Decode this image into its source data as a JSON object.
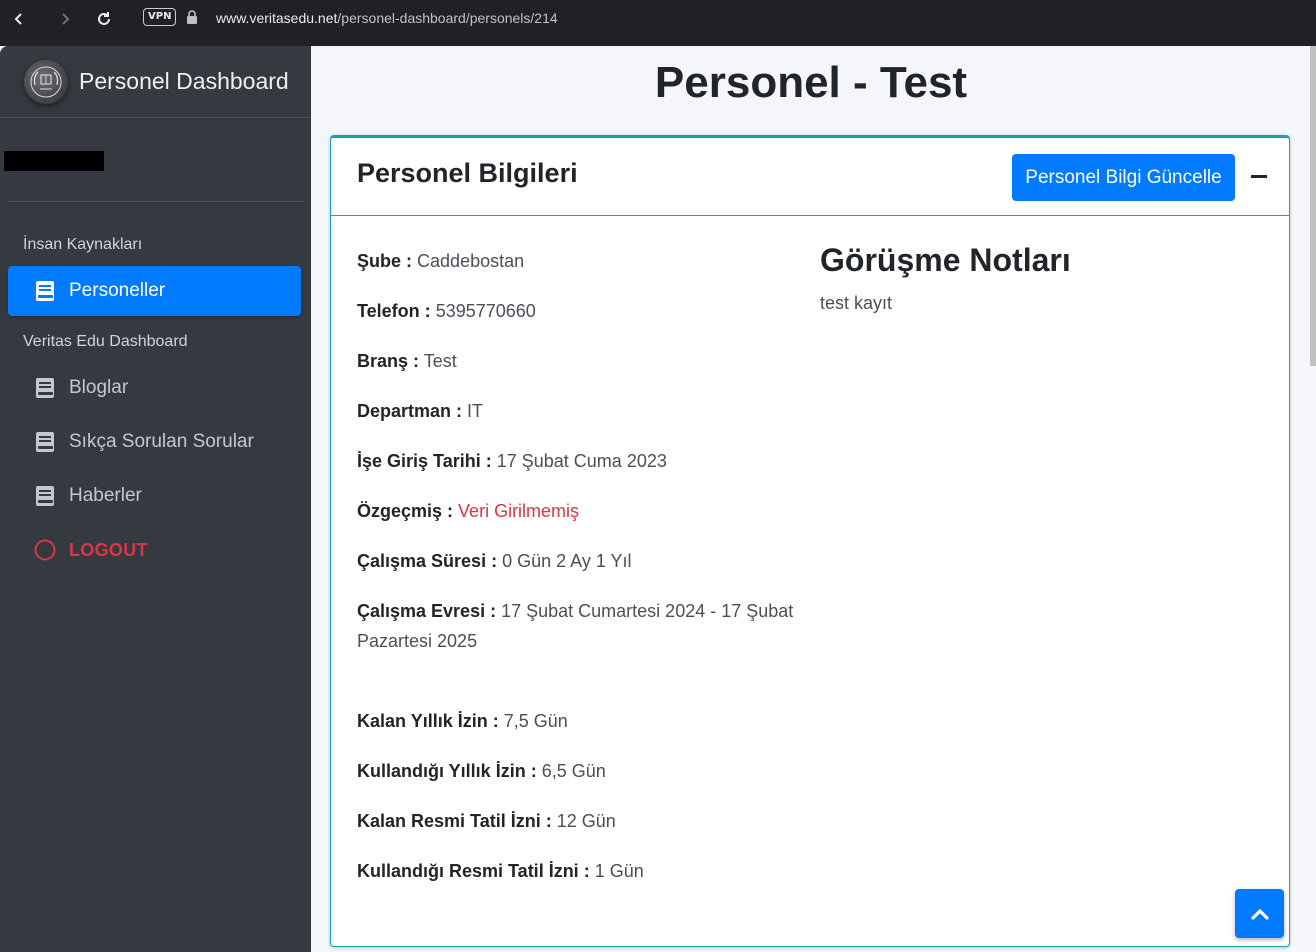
{
  "browser": {
    "vpn_label": "VPN",
    "url_host": "www.veritasedu.net",
    "url_path": "/personel-dashboard/personels/214"
  },
  "sidebar": {
    "brand_title": "Personel Dashboard",
    "sections": [
      {
        "header": "İnsan Kaynakları",
        "items": [
          {
            "label": "Personeller",
            "icon": "book-icon",
            "active": true
          }
        ]
      },
      {
        "header": "Veritas Edu Dashboard",
        "items": [
          {
            "label": "Bloglar",
            "icon": "book-icon"
          },
          {
            "label": "Sıkça Sorulan Sorular",
            "icon": "book-icon"
          },
          {
            "label": "Haberler",
            "icon": "book-icon"
          }
        ]
      }
    ],
    "logout_label": "LOGOUT"
  },
  "page": {
    "title": "Personel - Test"
  },
  "card": {
    "title": "Personel Bilgileri",
    "update_button": "Personel Bilgi Güncelle",
    "fields": [
      {
        "label": "Şube :",
        "value": "Caddebostan"
      },
      {
        "label": "Telefon :",
        "value": "5395770660"
      },
      {
        "label": "Branş :",
        "value": "Test"
      },
      {
        "label": "Departman :",
        "value": "IT"
      },
      {
        "label": "İşe Giriş Tarihi :",
        "value": "17 Şubat Cuma 2023"
      },
      {
        "label": "Özgeçmiş :",
        "value": "Veri Girilmemiş"
      },
      {
        "label": "Çalışma Süresi :",
        "value": "0 Gün 2 Ay 1 Yıl"
      },
      {
        "label": "Çalışma Evresi :",
        "value": "17 Şubat Cumartesi 2024 - 17 Şubat Pazartesi 2025"
      },
      {
        "label": "Kalan Yıllık İzin :",
        "value": "7,5 Gün"
      },
      {
        "label": "Kullandığı Yıllık İzin :",
        "value": "6,5 Gün"
      },
      {
        "label": "Kalan Resmi Tatil İzni :",
        "value": "12 Gün"
      },
      {
        "label": "Kullandığı Resmi Tatil İzni :",
        "value": "1 Gün"
      }
    ],
    "notes_title": "Görüşme Notları",
    "notes_text": "test kayıt"
  },
  "colors": {
    "primary": "#007bff",
    "info_border": "#17a2b8",
    "danger": "#dc3545",
    "sidebar_bg": "#343a40"
  }
}
